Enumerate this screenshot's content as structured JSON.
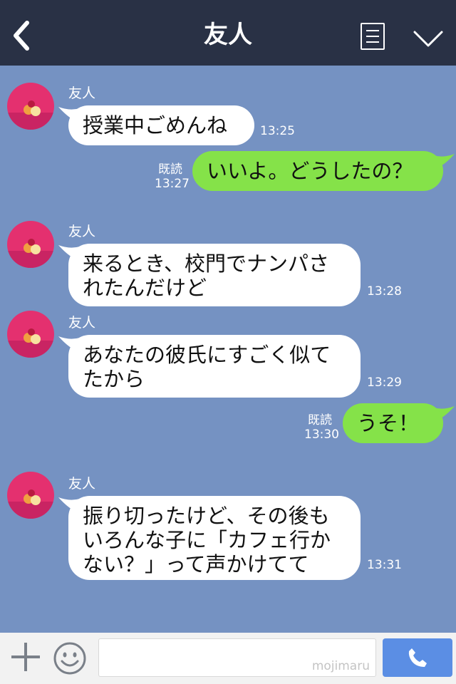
{
  "header": {
    "back_icon": "chevron-left-icon",
    "title": "友人",
    "menu_icon": "menu-list-icon",
    "expand_icon": "chevron-down-icon"
  },
  "messages": [
    {
      "sender": "友人",
      "text": "授業中ごめんね",
      "time": "13:25",
      "side": "in"
    },
    {
      "read": "既読",
      "time": "13:27",
      "text": "いいよ。どうしたの？",
      "side": "out"
    },
    {
      "sender": "友人",
      "text": "来るとき、校門でナンパさ\nれたんだけど",
      "time": "13:28",
      "side": "in"
    },
    {
      "sender": "友人",
      "text": "あなたの彼氏にすごく似て\nたから",
      "time": "13:29",
      "side": "in"
    },
    {
      "read": "既読",
      "time": "13:30",
      "text": "うそ！",
      "side": "out"
    },
    {
      "sender": "友人",
      "text": "振り切ったけど、その後も\nいろんな子に「カフェ行か\nない？」って声かけてて",
      "time": "13:31",
      "side": "in"
    }
  ],
  "footer": {
    "plus_icon": "plus-icon",
    "sticker_icon": "smiley-icon",
    "input_value": "",
    "watermark": "mojimaru",
    "call_icon": "phone-icon"
  },
  "colors": {
    "header_bg": "#293145",
    "chat_bg": "#7592c2",
    "outgoing_bubble": "#85e249",
    "incoming_bubble": "#ffffff",
    "call_button": "#5b8ee4"
  }
}
